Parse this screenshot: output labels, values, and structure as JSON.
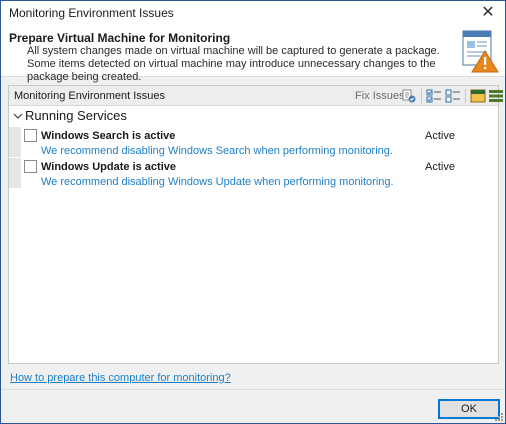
{
  "window": {
    "title": "Monitoring Environment Issues"
  },
  "header": {
    "title": "Prepare Virtual Machine for Monitoring",
    "description": "All system changes made on virtual machine will be captured to generate a package. Some items detected on virtual machine may introduce unnecessary changes to the package being created."
  },
  "panel": {
    "title": "Monitoring Environment Issues",
    "fix_issues_label": "Fix Issues",
    "group": {
      "label": "Running Services",
      "items": [
        {
          "name": "Windows Search is active",
          "status": "Active",
          "recommendation": "We recommend disabling Windows Search when performing monitoring."
        },
        {
          "name": "Windows Update is active",
          "status": "Active",
          "recommendation": "We recommend disabling Windows Update when performing monitoring."
        }
      ]
    }
  },
  "help_link": "How to prepare this computer for monitoring?",
  "footer": {
    "ok_label": "OK"
  },
  "colors": {
    "link": "#1e7fc7",
    "accent": "#0078d7",
    "warning": "#e8871e"
  }
}
